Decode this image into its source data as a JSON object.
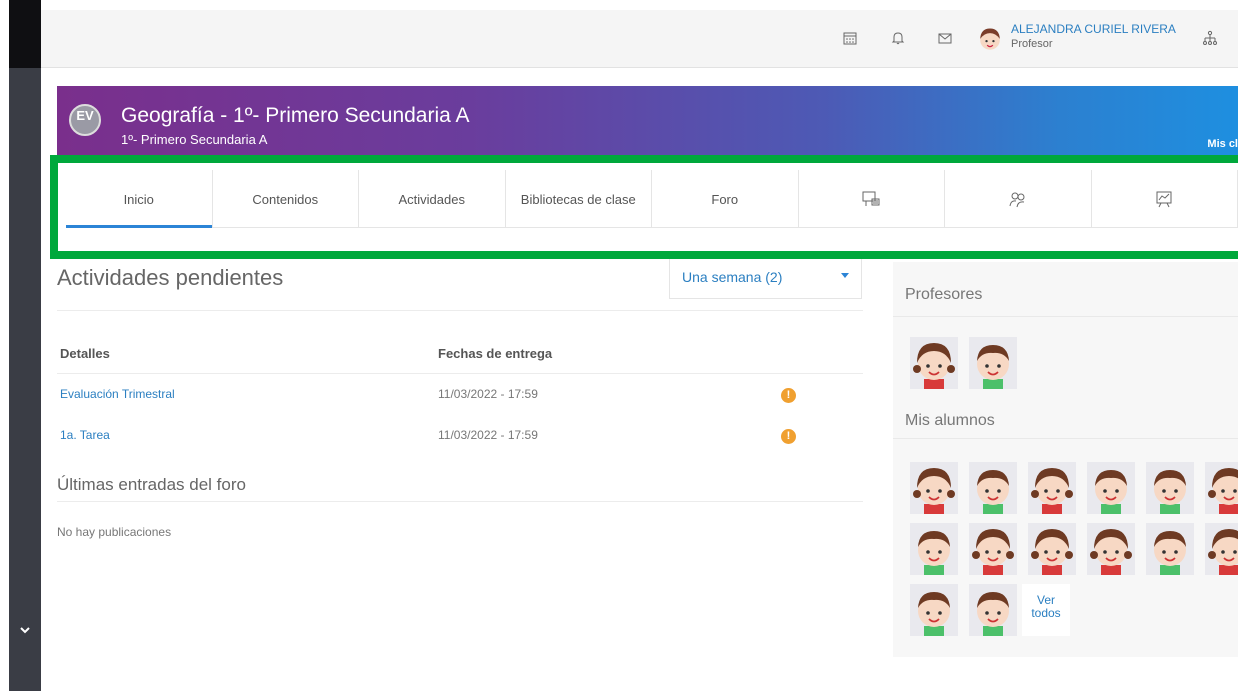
{
  "topbar": {
    "user_name": "ALEJANDRA CURIEL RIVERA",
    "user_role": "Profesor",
    "icons": [
      "calendar-icon",
      "bell-icon",
      "mail-icon",
      "avatar",
      "org-chart-icon"
    ]
  },
  "banner": {
    "logo": "EV",
    "title": "Geografía  - 1º- Primero Secundaria A",
    "subtitle": "1º- Primero Secundaria A",
    "right_text": "Mis cl"
  },
  "tabs": [
    {
      "label": "Inicio",
      "active": true
    },
    {
      "label": "Contenidos"
    },
    {
      "label": "Actividades"
    },
    {
      "label": "Bibliotecas de clase"
    },
    {
      "label": "Foro"
    },
    {
      "icon": "presentation-board-icon"
    },
    {
      "icon": "people-group-icon"
    },
    {
      "icon": "chart-board-icon"
    }
  ],
  "pending": {
    "title": "Actividades pendientes",
    "filter": "Una semana (2)",
    "col_details": "Detalles",
    "col_dates": "Fechas de entrega",
    "rows": [
      {
        "name": "Evaluación Trimestral",
        "date": "11/03/2022 - 17:59",
        "status": "!"
      },
      {
        "name": "1a. Tarea",
        "date": "11/03/2022 - 17:59",
        "status": "!"
      }
    ]
  },
  "forum": {
    "title": "Últimas entradas del foro",
    "empty": "No hay publicaciones"
  },
  "side": {
    "teachers_title": "Profesores",
    "students_title": "Mis alumnos",
    "see_all": "Ver todos",
    "teachers": [
      "girl",
      "boy"
    ],
    "students": [
      "girl",
      "boy",
      "girl",
      "boy",
      "boy",
      "girl",
      "boy",
      "girl",
      "girl",
      "girl",
      "boy",
      "girl",
      "boy",
      "boy"
    ]
  },
  "colors": {
    "accent": "#2b84d6",
    "highlight": "#00a83c",
    "warning": "#f0a030"
  }
}
